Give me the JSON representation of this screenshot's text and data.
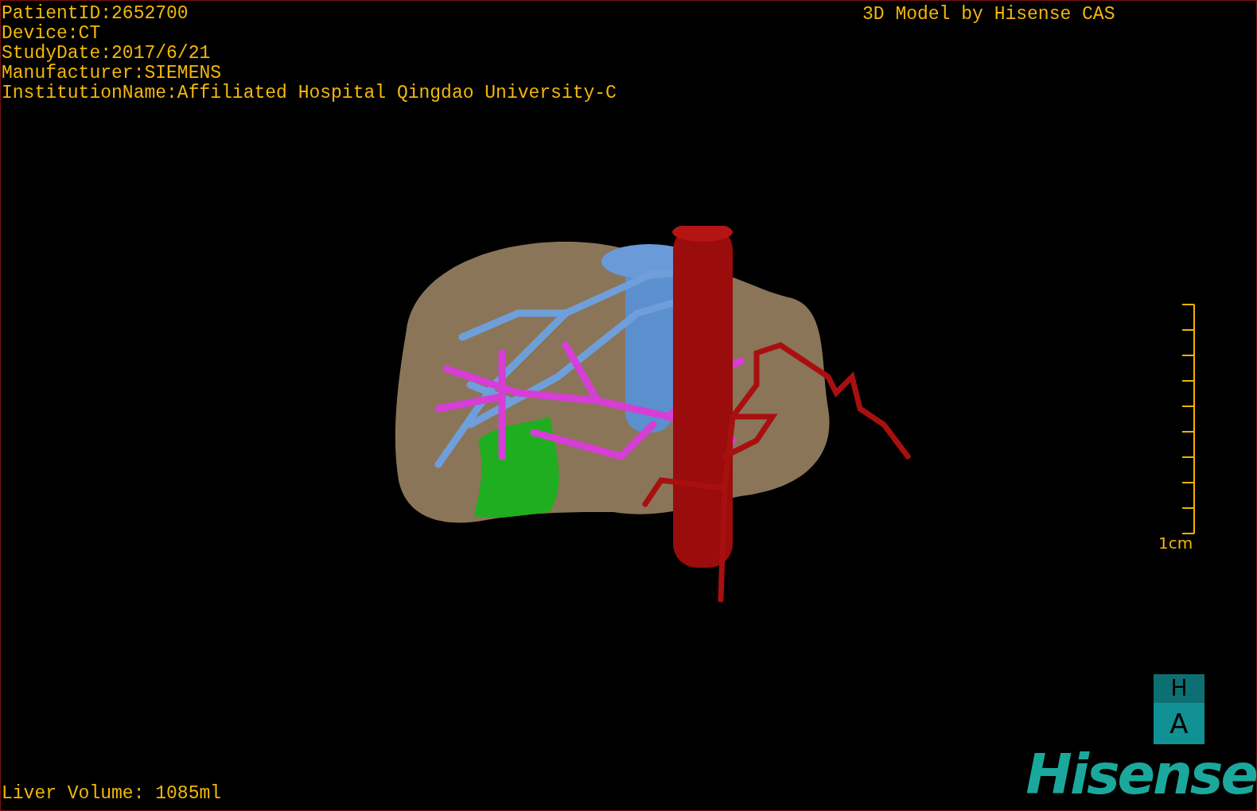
{
  "info_lines": [
    "PatientID:2652700",
    "Device:CT",
    "StudyDate:2017/6/21",
    "Manufacturer:SIEMENS",
    "InstitutionName:Affiliated Hospital Qingdao University-C"
  ],
  "title": "3D Model by Hisense CAS",
  "scale_bar": {
    "label": "1cm"
  },
  "orientation_marker": {
    "top": "H",
    "bottom": "A"
  },
  "liver_volume": "Liver Volume: 1085ml",
  "logo": "Hisense"
}
